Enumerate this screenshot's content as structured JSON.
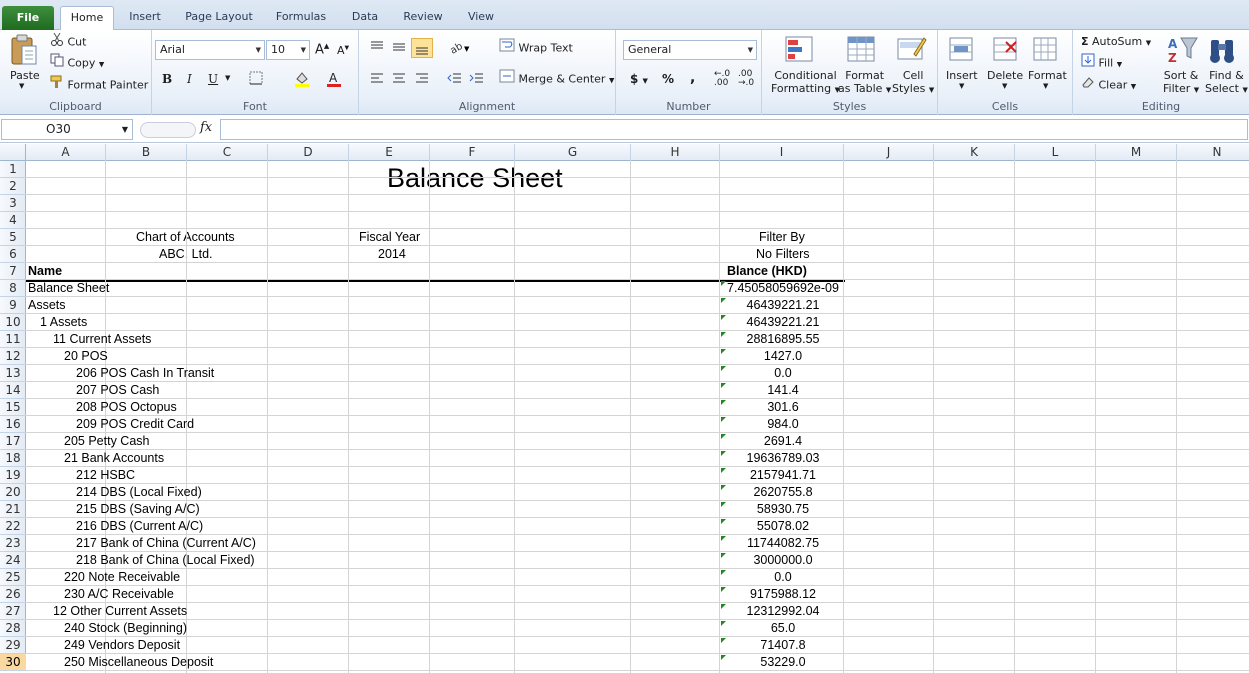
{
  "tabs": [
    "File",
    "Home",
    "Insert",
    "Page Layout",
    "Formulas",
    "Data",
    "Review",
    "View"
  ],
  "active_tab": "Home",
  "ribbon": {
    "clipboard": {
      "label": "Clipboard",
      "paste": "Paste",
      "cut": "Cut",
      "copy": "Copy",
      "format_painter": "Format Painter"
    },
    "font": {
      "label": "Font",
      "name": "Arial",
      "size": "10"
    },
    "alignment": {
      "label": "Alignment",
      "wrap_text": "Wrap Text",
      "merge_center": "Merge & Center"
    },
    "number": {
      "label": "Number",
      "format": "General",
      "currency": "$",
      "percent": "%",
      "comma": ","
    },
    "styles": {
      "label": "Styles",
      "conditional_1": "Conditional",
      "conditional_2": "Formatting",
      "format_table_1": "Format",
      "format_table_2": "as Table",
      "cell_styles_1": "Cell",
      "cell_styles_2": "Styles"
    },
    "cells": {
      "label": "Cells",
      "insert": "Insert",
      "delete": "Delete",
      "format": "Format"
    },
    "editing": {
      "label": "Editing",
      "autosum": "AutoSum",
      "fill": "Fill",
      "clear": "Clear",
      "sort_1": "Sort &",
      "sort_2": "Filter",
      "find_1": "Find &",
      "find_2": "Select"
    }
  },
  "formula_bar": {
    "name_box": "O30",
    "fx": "fx",
    "content": ""
  },
  "columns": [
    "A",
    "B",
    "C",
    "D",
    "E",
    "F",
    "G",
    "H",
    "I",
    "J",
    "K",
    "L",
    "M",
    "N"
  ],
  "rows": [
    "1",
    "2",
    "3",
    "4",
    "5",
    "6",
    "7",
    "8",
    "9",
    "10",
    "11",
    "12",
    "13",
    "14",
    "15",
    "16",
    "17",
    "18",
    "19",
    "20",
    "21",
    "22",
    "23",
    "24",
    "25",
    "26",
    "27",
    "28",
    "29",
    "30"
  ],
  "selected_row": "30",
  "sheet": {
    "title": "Balance Sheet",
    "chart_of_accounts_label": "Chart of Accounts",
    "company": "ABC. Ltd.",
    "fiscal_year_label": "Fiscal Year",
    "fiscal_year": "2014",
    "filter_label": "Filter By",
    "filter_value": "No Filters",
    "name_header": "Name",
    "balance_header": "Blance (HKD)",
    "entries": [
      {
        "name": "Balance Sheet",
        "value": "7.45058059692e-09"
      },
      {
        "name": "Assets",
        "value": "46439221.21"
      },
      {
        "name": "1 Assets",
        "value": "46439221.21"
      },
      {
        "name": "11 Current Assets",
        "value": "28816895.55"
      },
      {
        "name": "20 POS",
        "value": "1427.0"
      },
      {
        "name": "206 POS Cash In Transit",
        "value": "0.0"
      },
      {
        "name": "207 POS Cash",
        "value": "141.4"
      },
      {
        "name": "208 POS Octopus",
        "value": "301.6"
      },
      {
        "name": "209 POS Credit Card",
        "value": "984.0"
      },
      {
        "name": "205 Petty Cash",
        "value": "2691.4"
      },
      {
        "name": "21 Bank Accounts",
        "value": "19636789.03"
      },
      {
        "name": "212 HSBC",
        "value": "2157941.71"
      },
      {
        "name": "214 DBS (Local Fixed)",
        "value": "2620755.8"
      },
      {
        "name": "215 DBS (Saving A/C)",
        "value": "58930.75"
      },
      {
        "name": "216 DBS (Current A/C)",
        "value": "55078.02"
      },
      {
        "name": "217 Bank of China (Current A/C)",
        "value": "11744082.75"
      },
      {
        "name": "218 Bank of China (Local Fixed)",
        "value": "3000000.0"
      },
      {
        "name": "220 Note Receivable",
        "value": "0.0"
      },
      {
        "name": "230 A/C Receivable",
        "value": "9175988.12"
      },
      {
        "name": "12 Other Current Assets",
        "value": "12312992.04"
      },
      {
        "name": "240 Stock (Beginning)",
        "value": "65.0"
      },
      {
        "name": "249 Vendors Deposit",
        "value": "71407.8"
      },
      {
        "name": "250 Miscellaneous Deposit",
        "value": "53229.0"
      }
    ]
  }
}
